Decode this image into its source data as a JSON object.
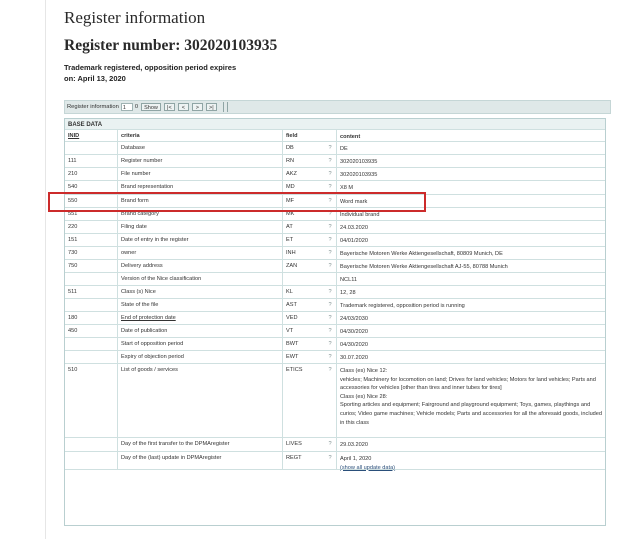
{
  "header": {
    "title": "Register information",
    "register_number": "Register number: 302020103935",
    "status_line1": "Trademark registered, opposition period expires",
    "status_line2": "on: April 13, 2020"
  },
  "toolbar": {
    "label": "Register information",
    "input_value": "1",
    "of_text": "0",
    "show_label": "Show",
    "first_label": "|<",
    "prev_label": "<",
    "next_label": ">",
    "last_label": ">|"
  },
  "table": {
    "section_title": "BASE DATA",
    "headers": {
      "inid": "INID",
      "criteria": "criteria",
      "field": "field",
      "content": "content"
    },
    "rows": [
      {
        "inid": "",
        "criteria": "Database",
        "field": "DB",
        "q": "?",
        "content": "DE"
      },
      {
        "inid": "111",
        "criteria": "Register number",
        "field": "RN",
        "q": "?",
        "content": "302020103935"
      },
      {
        "inid": "210",
        "criteria": "File number",
        "field": "AKZ",
        "q": "?",
        "content": "302020103935"
      },
      {
        "inid": "540",
        "criteria": "Brand representation",
        "field": "MD",
        "q": "?",
        "content": "X8 M"
      },
      {
        "inid": "550",
        "criteria": "Brand form",
        "field": "MF",
        "q": "?",
        "content": "Word mark"
      },
      {
        "inid": "551",
        "criteria": "Brand category",
        "field": "MK",
        "q": "?",
        "content": "Individual brand"
      },
      {
        "inid": "220",
        "criteria": "Filing date",
        "field": "AT",
        "q": "?",
        "content": "24.03.2020"
      },
      {
        "inid": "151",
        "criteria": "Date of entry in the register",
        "field": "ET",
        "q": "?",
        "content": "04/01/2020"
      },
      {
        "inid": "730",
        "criteria": "owner",
        "field": "INH",
        "q": "?",
        "content": "Bayerische Motoren Werke Aktiengesellschaft, 80809 Munich, DE"
      },
      {
        "inid": "750",
        "criteria": "Delivery address",
        "field": "ZAN",
        "q": "?",
        "content": "Bayerische Motoren Werke Aktiengesellschaft AJ-55, 80788 Munich"
      },
      {
        "inid": "",
        "criteria": "Version of the Nice classification",
        "field": "",
        "q": "",
        "content": "NCL11"
      },
      {
        "inid": "511",
        "criteria": "Class (s) Nice",
        "field": "KL",
        "q": "?",
        "content": "12, 28"
      },
      {
        "inid": "",
        "criteria": "State of the file",
        "field": "AST",
        "q": "?",
        "content": "Trademark registered, opposition period is running"
      },
      {
        "inid": "180",
        "criteria": "End of protection date",
        "field": "VED",
        "q": "?",
        "content": "24/03/2030"
      },
      {
        "inid": "450",
        "criteria": "Date of publication",
        "field": "VT",
        "q": "?",
        "content": "04/30/2020"
      },
      {
        "inid": "",
        "criteria": "Start of opposition period",
        "field": "BWT",
        "q": "?",
        "content": "04/30/2020"
      },
      {
        "inid": "",
        "criteria": "Expiry of objection period",
        "field": "EWT",
        "q": "?",
        "content": "30.07.2020"
      },
      {
        "inid": "510",
        "criteria": "List of goods / services",
        "field": "ETICS",
        "q": "?",
        "content": "Class (es) Nice 12:\nvehicles; Machinery for locomotion on land; Drives for land vehicles; Motors for land vehicles; Parts and accessories for vehicles [other than tires and inner tubes for tires]\nClass (es) Nice 28:\nSporting articles and equipment; Fairground and playground equipment; Toys, games, playthings and curios; Video game machines; Vehicle models; Parts and accessories for all the aforesaid goods, included in this class"
      },
      {
        "inid": "",
        "criteria": "Day of the first transfer to the DPMAregister",
        "field": "LIVES",
        "q": "?",
        "content": "29.03.2020"
      },
      {
        "inid": "",
        "criteria": "Day of the (last) update in DPMAregister",
        "field": "REGT",
        "q": "?",
        "content": "April 1, 2020",
        "link": "(show all update data)"
      }
    ]
  }
}
